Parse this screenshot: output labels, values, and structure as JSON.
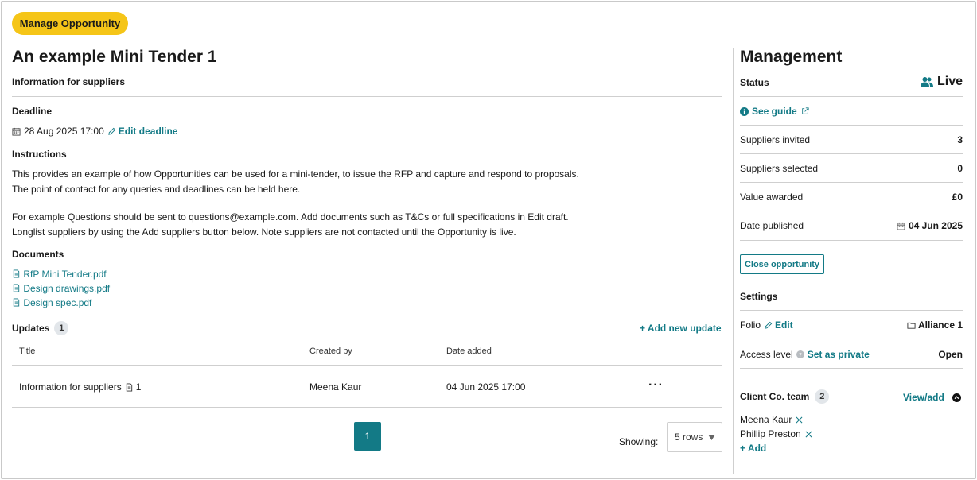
{
  "header": {
    "manage_label": "Manage Opportunity",
    "title": "An example Mini Tender 1",
    "subtitle": "Information for suppliers"
  },
  "deadline": {
    "heading": "Deadline",
    "value": "28 Aug 2025 17:00",
    "edit_label": "Edit deadline"
  },
  "instructions": {
    "heading": "Instructions",
    "lines": [
      "This provides an example of how Opportunities can be used for a mini-tender, to issue the RFP and capture and respond to proposals.",
      "The point of contact for any queries and deadlines can be held here.",
      "For example Questions should be sent to questions@example.com. Add documents such as T&Cs or full specifications in Edit draft.",
      "Longlist suppliers by using the Add suppliers button below. Note suppliers are not contacted until the Opportunity is live."
    ]
  },
  "documents": {
    "heading": "Documents",
    "items": [
      "RfP Mini Tender.pdf",
      "Design drawings.pdf",
      "Design spec.pdf"
    ]
  },
  "updates": {
    "heading": "Updates",
    "count": "1",
    "add_label": "+ Add new update",
    "columns": [
      "Title",
      "Created by",
      "Date added"
    ],
    "rows": [
      {
        "title": "Information for suppliers",
        "attachments": "1",
        "created_by": "Meena Kaur",
        "date_added": "04 Jun 2025 17:00",
        "menu": "···"
      }
    ],
    "page": "1",
    "showing_label": "Showing:",
    "rows_option": "5 rows"
  },
  "management": {
    "heading": "Management",
    "status_label": "Status",
    "status_value": "Live",
    "guide_label": "See guide",
    "stats": [
      {
        "label": "Suppliers invited",
        "value": "3"
      },
      {
        "label": "Suppliers selected",
        "value": "0"
      },
      {
        "label": "Value awarded",
        "value": "£0"
      },
      {
        "label": "Date published",
        "value": "04 Jun 2025"
      }
    ],
    "close_label": "Close opportunity",
    "settings_heading": "Settings",
    "folio_label": "Folio",
    "folio_edit": "Edit",
    "folio_value": "Alliance 1",
    "access_label": "Access level",
    "access_action": "Set as private",
    "access_value": "Open",
    "team_heading": "Client Co. team",
    "team_count": "2",
    "team_view": "View/add",
    "team_members": [
      "Meena Kaur",
      "Phillip Preston"
    ],
    "team_add": "+ Add"
  },
  "colors": {
    "accent": "#137a86",
    "pill": "#f5c518"
  }
}
